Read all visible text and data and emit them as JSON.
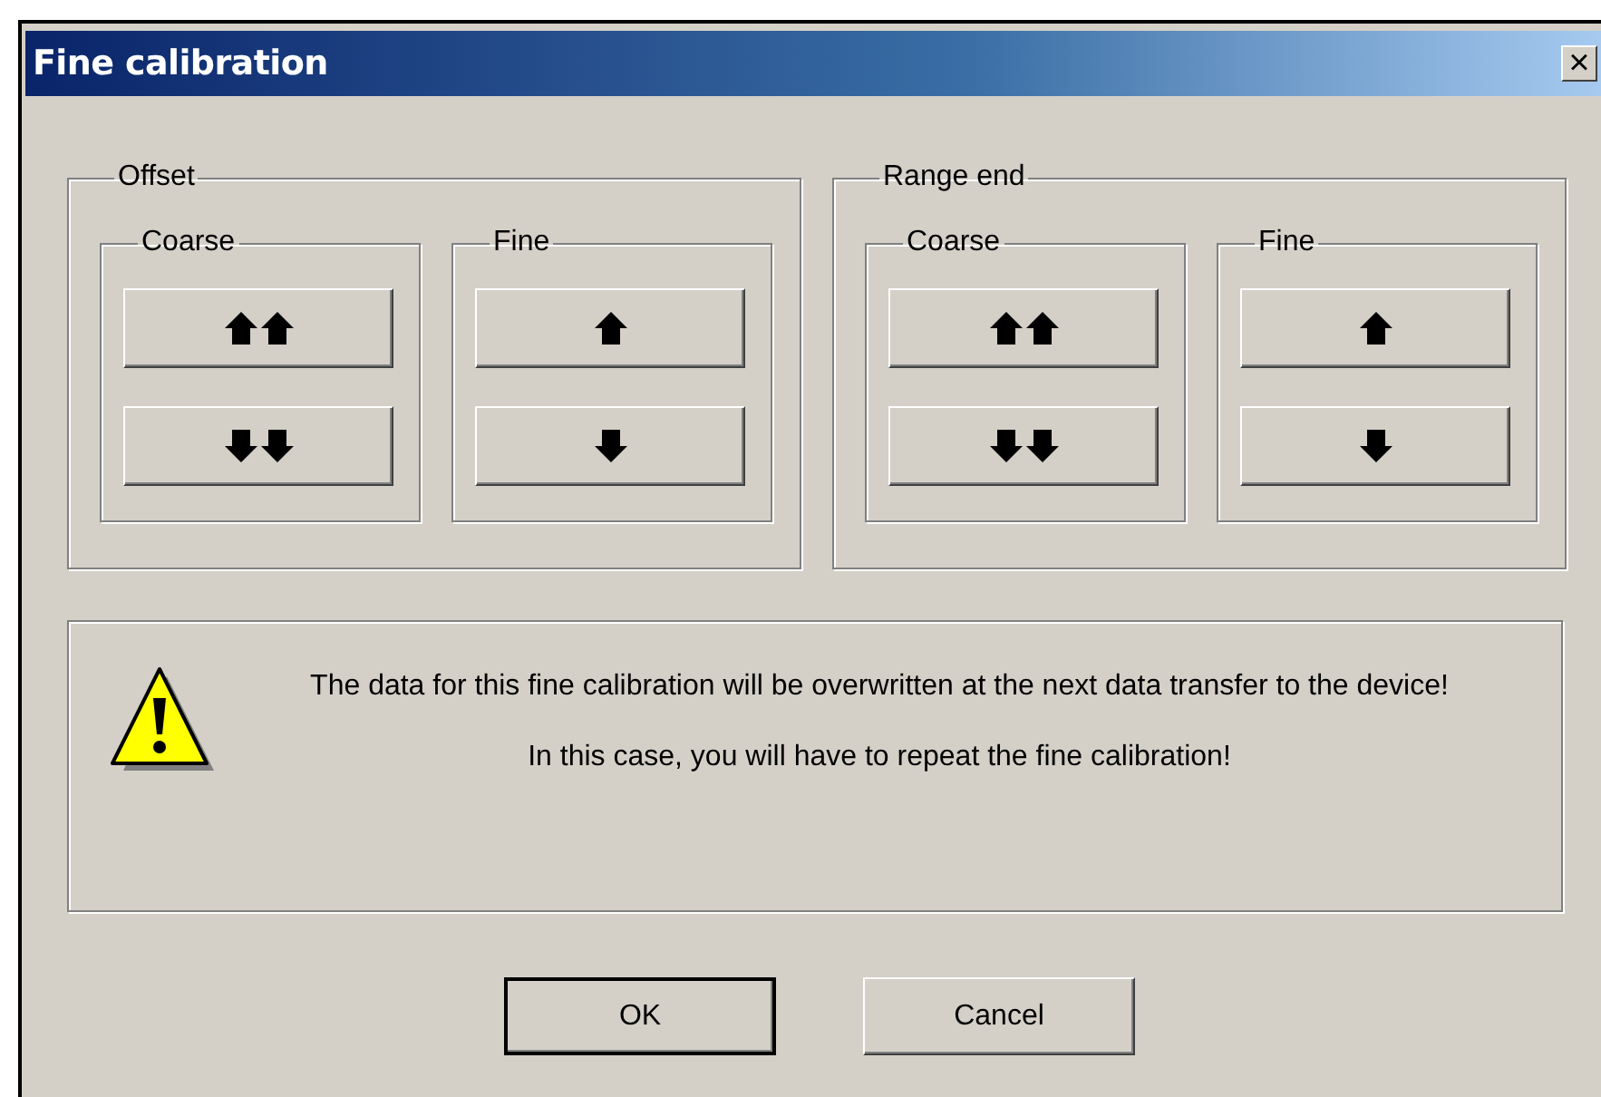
{
  "window": {
    "title": "Fine calibration",
    "close": "×"
  },
  "groups": [
    {
      "label": "Offset",
      "subgroups": [
        {
          "label": "Coarse",
          "buttons": [
            {
              "kind": "double-up"
            },
            {
              "kind": "double-down"
            }
          ]
        },
        {
          "label": "Fine",
          "buttons": [
            {
              "kind": "up"
            },
            {
              "kind": "down"
            }
          ]
        }
      ]
    },
    {
      "label": "Range end",
      "subgroups": [
        {
          "label": "Coarse",
          "buttons": [
            {
              "kind": "double-up"
            },
            {
              "kind": "double-down"
            }
          ]
        },
        {
          "label": "Fine",
          "buttons": [
            {
              "kind": "up"
            },
            {
              "kind": "down"
            }
          ]
        }
      ]
    }
  ],
  "message": {
    "lines": [
      "The data for this fine calibration will be overwritten at the next data transfer to the device!",
      "In this case, you will have to repeat the fine calibration!"
    ]
  },
  "buttons": [
    {
      "label": "OK",
      "default": true
    },
    {
      "label": "Cancel",
      "default": false
    }
  ]
}
